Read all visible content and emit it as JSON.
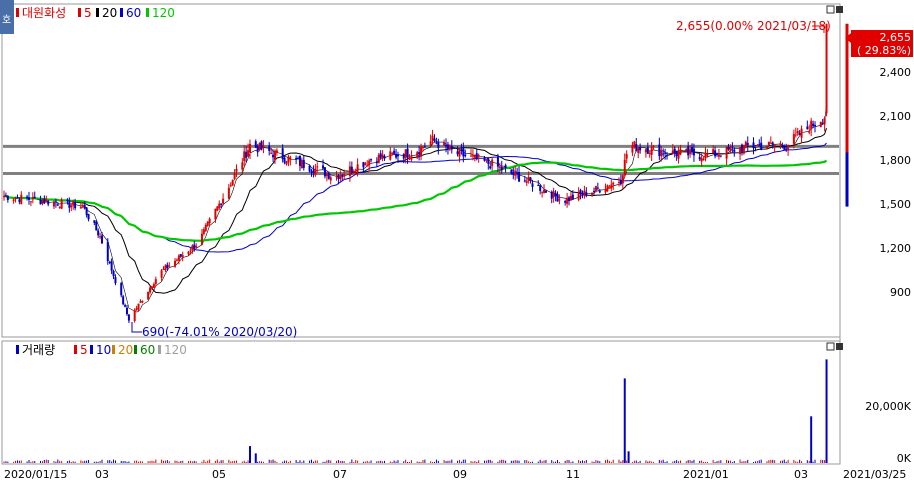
{
  "price_panel": {
    "legend": {
      "name": "대원화성",
      "items": [
        {
          "label": "5",
          "color": "#e00000"
        },
        {
          "label": "20",
          "color": "#000000"
        },
        {
          "label": "60",
          "color": "#0000c8"
        },
        {
          "label": "120",
          "color": "#00c800"
        }
      ]
    },
    "max_annotation": "2,655(0.00% 2021/03/18)",
    "min_annotation": "690(-74.01% 2020/03/20)",
    "current_price": "2,655",
    "current_change": "( 29.83%)",
    "y_ticks": [
      "2,400",
      "2,100",
      "1,800",
      "1,500",
      "1,200",
      "900"
    ]
  },
  "volume_panel": {
    "legend": {
      "name": "거래량",
      "items": [
        {
          "label": "5",
          "color": "#e00000"
        },
        {
          "label": "10",
          "color": "#0000c8"
        },
        {
          "label": "20",
          "color": "#d08000"
        },
        {
          "label": "60",
          "color": "#008000"
        },
        {
          "label": "120",
          "color": "#a0a0a0"
        }
      ]
    },
    "y_ticks": [
      "20,000K",
      "0K"
    ]
  },
  "x_ticks": [
    "2020/01/15",
    "03",
    "05",
    "07",
    "09",
    "11",
    "2021/01",
    "03",
    "2021/03/25"
  ],
  "colors": {
    "up": "#e00000",
    "down": "#0000c8",
    "sma5": "#000000",
    "sma60": "#0000c8",
    "sma120": "#00c800",
    "hline": "#808080"
  },
  "chart_data": {
    "type": "candlestick",
    "series": [
      {
        "name": "5",
        "note": "price moving average"
      },
      {
        "name": "20"
      },
      {
        "name": "60"
      },
      {
        "name": "120"
      }
    ],
    "price_range": [
      600,
      2760
    ],
    "max_close": 2655,
    "min_close": 690,
    "trend_points": [
      {
        "date": "2020/01/15",
        "price": 1510
      },
      {
        "date": "2020/02/10",
        "price": 1470
      },
      {
        "date": "2020/02/25",
        "price": 1440
      },
      {
        "date": "2020/03/05",
        "price": 1240
      },
      {
        "date": "2020/03/20",
        "price": 690
      },
      {
        "date": "2020/04/05",
        "price": 1000
      },
      {
        "date": "2020/04/25",
        "price": 1200
      },
      {
        "date": "2020/05/10",
        "price": 1550
      },
      {
        "date": "2020/05/22",
        "price": 1850
      },
      {
        "date": "2020/06/15",
        "price": 1740
      },
      {
        "date": "2020/07/05",
        "price": 1640
      },
      {
        "date": "2020/07/25",
        "price": 1760
      },
      {
        "date": "2020/08/15",
        "price": 1800
      },
      {
        "date": "2020/08/25",
        "price": 1880
      },
      {
        "date": "2020/09/05",
        "price": 1800
      },
      {
        "date": "2020/09/25",
        "price": 1720
      },
      {
        "date": "2020/10/15",
        "price": 1600
      },
      {
        "date": "2020/11/01",
        "price": 1480
      },
      {
        "date": "2020/11/20",
        "price": 1560
      },
      {
        "date": "2020/12/01",
        "price": 1620
      },
      {
        "date": "2020/12/05",
        "price": 1850
      },
      {
        "date": "2020/12/25",
        "price": 1800
      },
      {
        "date": "2021/01/15",
        "price": 1780
      },
      {
        "date": "2021/02/05",
        "price": 1840
      },
      {
        "date": "2021/02/25",
        "price": 1850
      },
      {
        "date": "2021/03/10",
        "price": 1980
      },
      {
        "date": "2021/03/17",
        "price": 2040
      },
      {
        "date": "2021/03/18",
        "price": 2655
      }
    ],
    "horizontal_lines": [
      1840,
      1660
    ],
    "volume_range": [
      0,
      37000
    ],
    "volume_spikes_k": [
      {
        "date": "2020/05/22",
        "value": 5800
      },
      {
        "date": "2020/05/25",
        "value": 3300
      },
      {
        "date": "2020/12/03",
        "value": 29000
      },
      {
        "date": "2020/12/05",
        "value": 4000
      },
      {
        "date": "2021/03/10",
        "value": 16000
      },
      {
        "date": "2021/03/18",
        "value": 35500
      }
    ]
  }
}
